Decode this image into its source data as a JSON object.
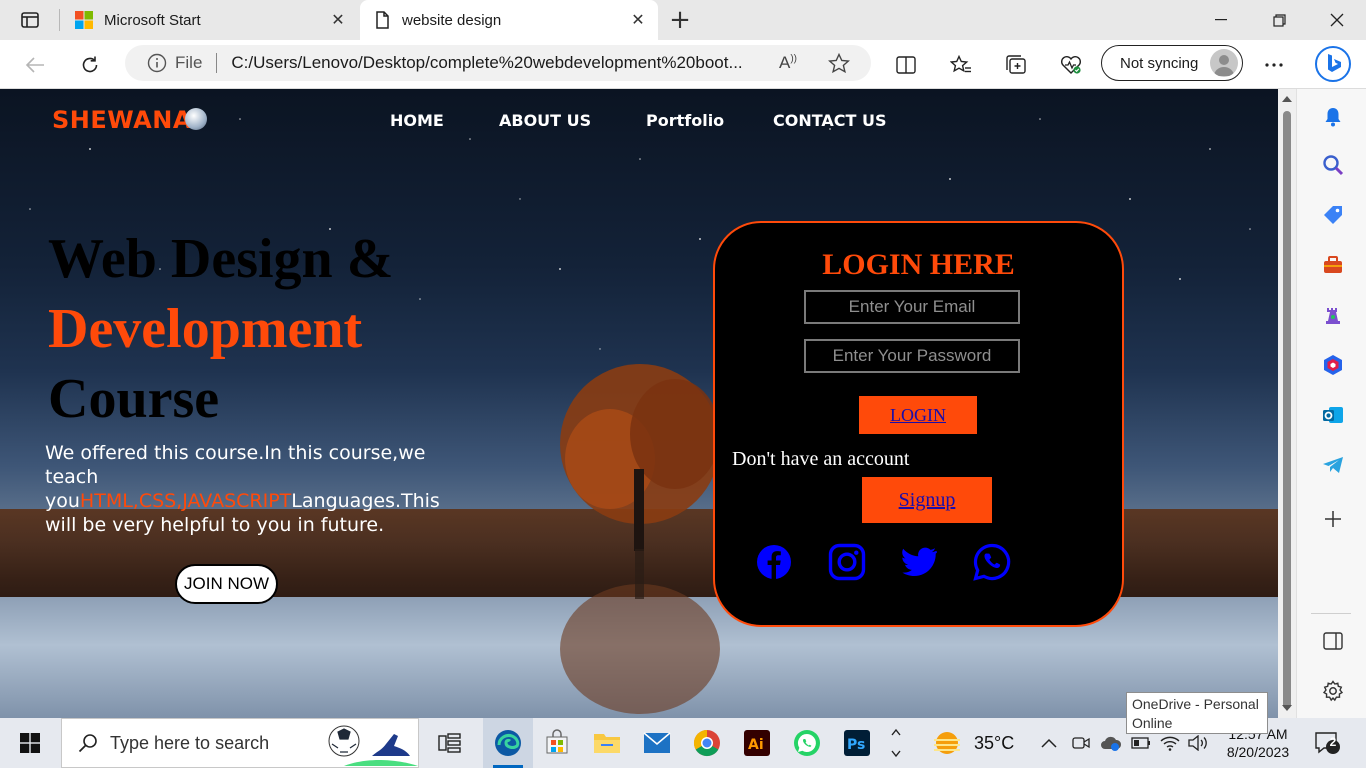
{
  "browser": {
    "tabs": [
      {
        "title": "Microsoft Start",
        "active": false
      },
      {
        "title": "website design",
        "active": true
      }
    ],
    "address": {
      "scheme": "File",
      "url": "C:/Users/Lenovo/Desktop/complete%20webdevelopment%20boot..."
    },
    "sync_label": "Not syncing",
    "icons": [
      "tab-actions-icon",
      "back-icon",
      "refresh-icon",
      "info-icon",
      "read-aloud-icon",
      "favorite-star-icon",
      "split-screen-icon",
      "favorites-icon",
      "collections-icon",
      "browser-essentials-icon",
      "more-icon",
      "bing-chat-icon"
    ]
  },
  "sidebar": {
    "icons": [
      "bell-icon",
      "search-icon",
      "shopping-tag-icon",
      "tools-icon",
      "games-icon",
      "office-icon",
      "outlook-icon",
      "telegram-icon",
      "add-icon",
      "sidebar-toggle-icon",
      "settings-icon"
    ]
  },
  "site": {
    "brand": "SHEWANA",
    "nav": [
      "HOME",
      "ABOUT US",
      "Portfolio",
      "CONTACT US"
    ],
    "hero": {
      "line1": "Web Design &",
      "line2": "Development",
      "line3": "Course",
      "desc_before": "We offered this course.In this course,we teach you",
      "desc_highlight": "HTML,CSS,JAVASCRIPT",
      "desc_after": "Languages.This will be very helpful to you in future.",
      "join_label": "JOIN NOW"
    },
    "login": {
      "title": "LOGIN HERE",
      "email_placeholder": "Enter Your Email",
      "password_placeholder": "Enter Your Password",
      "login_label": "LOGIN",
      "no_account": "Don't have an account",
      "signup_label": "Signup",
      "social": [
        "facebook-icon",
        "instagram-icon",
        "twitter-icon",
        "whatsapp-icon"
      ]
    },
    "colors": {
      "accent": "#ff4a0a",
      "link": "#1a0dab",
      "social": "#0000ff"
    }
  },
  "taskbar": {
    "search_placeholder": "Type here to search",
    "weather": "35°C",
    "time": "12:57 AM",
    "date": "8/20/2023",
    "notifications": "2",
    "tooltip": "OneDrive - Personal Online"
  }
}
